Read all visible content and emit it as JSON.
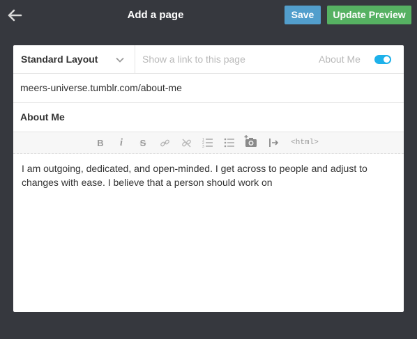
{
  "header": {
    "title": "Add a page",
    "back_icon": "arrow-left-icon",
    "save_label": "Save",
    "preview_label": "Update Preview"
  },
  "form": {
    "layout": {
      "selected": "Standard Layout",
      "icon": "chevron-down-icon"
    },
    "link": {
      "placeholder": "Show a link to this page",
      "value": "",
      "label": "About Me",
      "toggle_on": true
    },
    "url": "meers-universe.tumblr.com/about-me",
    "page_title": "About Me"
  },
  "toolbar": {
    "bold": "B",
    "italic": "i",
    "strike": "S",
    "html": "<html>",
    "icons": [
      "bold-icon",
      "italic-icon",
      "strikethrough-icon",
      "link-icon",
      "unlink-icon",
      "ordered-list-icon",
      "unordered-list-icon",
      "camera-icon",
      "read-more-icon",
      "html-icon"
    ]
  },
  "editor": {
    "content": "I am outgoing, dedicated, and open-minded. I get across to people and adjust to\nchanges with ease. I believe that a person should work on"
  },
  "colors": {
    "background": "#36383e",
    "save": "#529ecc",
    "preview": "#56b162",
    "toggle": "#1eb1ea"
  }
}
